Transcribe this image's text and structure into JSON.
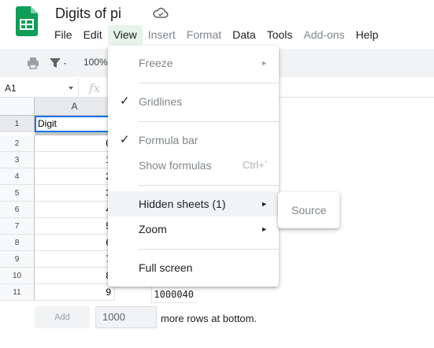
{
  "doc": {
    "title": "Digits of pi"
  },
  "icons": {
    "logo": "sheets-logo-icon",
    "cloud": "cloud-saved-icon"
  },
  "colors": {
    "sheets_green": "#0f9d58",
    "selection_blue": "#1a73e8",
    "active_menu_bg": "#e6f4ea"
  },
  "menubar": {
    "file": "File",
    "edit": "Edit",
    "view": "View",
    "insert": "Insert",
    "format": "Format",
    "data": "Data",
    "tools": "Tools",
    "addons": "Add-ons",
    "help": "Help"
  },
  "toolbar": {
    "zoom": "100%"
  },
  "formula": {
    "namebox": "A1",
    "fx": "fx"
  },
  "grid": {
    "column": "A",
    "rows": [
      "1",
      "2",
      "3",
      "4",
      "5",
      "6",
      "7",
      "8",
      "9",
      "10",
      "11"
    ],
    "cells": [
      "Digit",
      "0",
      "1",
      "2",
      "3",
      "4",
      "5",
      "6",
      "7",
      "8",
      "9"
    ],
    "partial_value": "1000040"
  },
  "add_rows": {
    "button": "Add",
    "value": "1000",
    "suffix": "more rows at bottom."
  },
  "view_menu": {
    "freeze": "Freeze",
    "gridlines": "Gridlines",
    "formula_bar": "Formula bar",
    "show_formulas": "Show formulas",
    "show_formulas_shortcut": "Ctrl+`",
    "hidden_sheets": "Hidden sheets (1)",
    "zoom": "Zoom",
    "full_screen": "Full screen",
    "check": "✓",
    "arrow": "►"
  },
  "hidden_sheets_submenu": {
    "item": "Source"
  }
}
